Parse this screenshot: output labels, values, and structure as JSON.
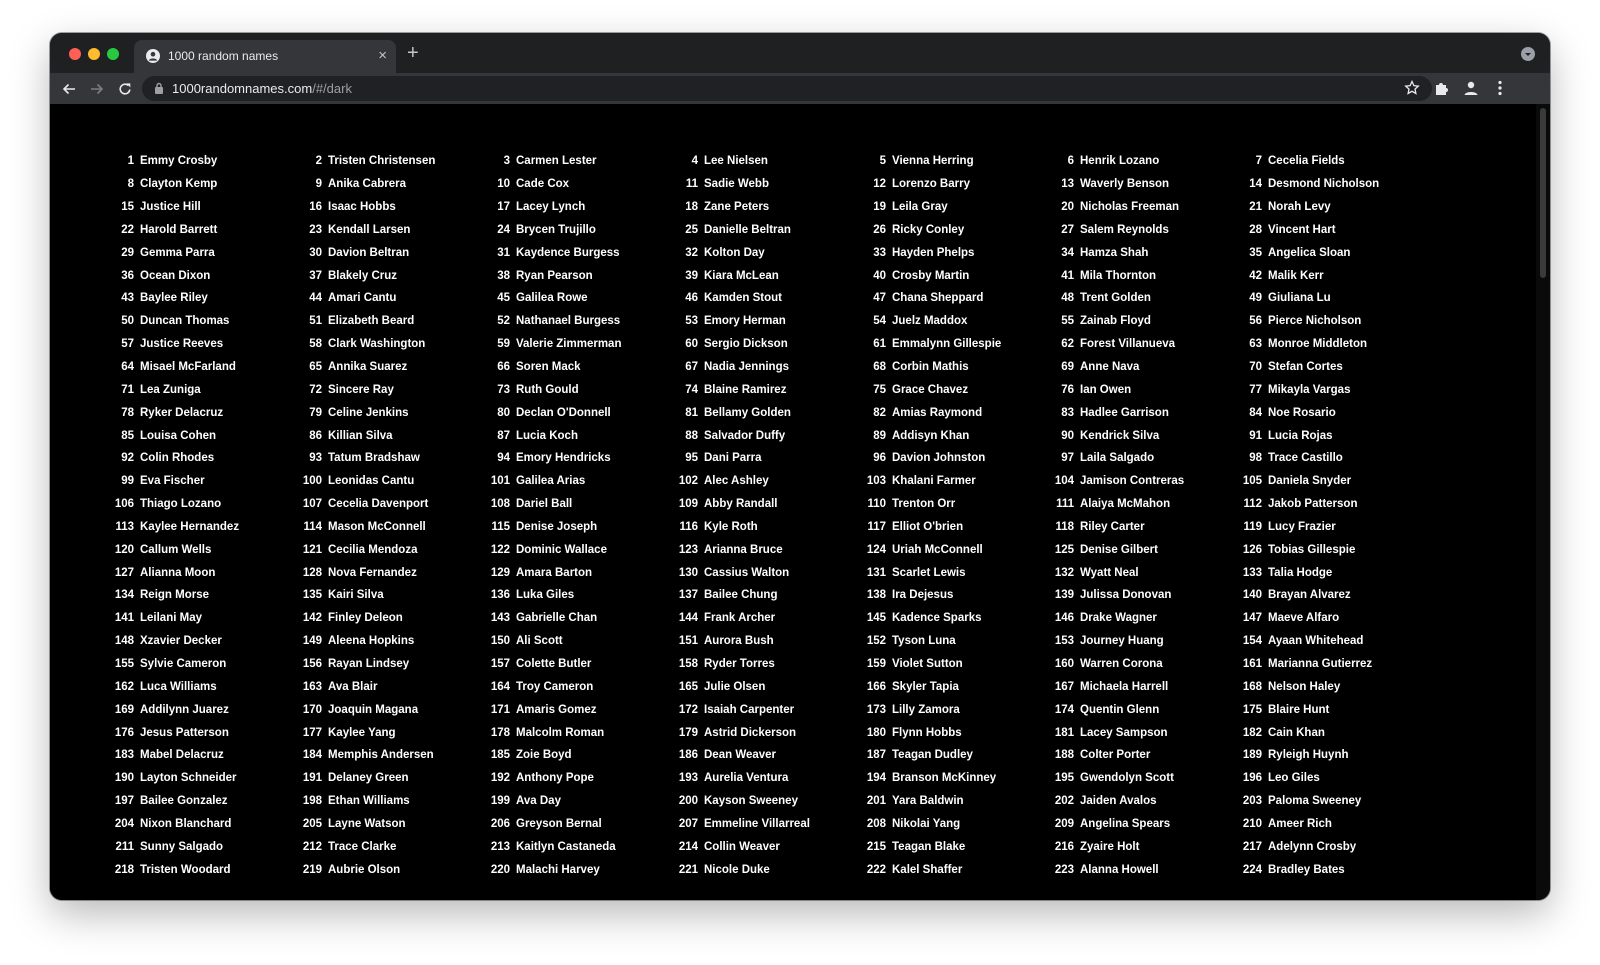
{
  "browser": {
    "tab_title": "1000 random names",
    "url_host": "1000randomnames.com",
    "url_path": "/#/dark",
    "tab_close_glyph": "×",
    "new_tab_glyph": "+"
  },
  "colors": {
    "page_background": "#000000",
    "text": "#ffffff",
    "tab_bar": "#1f2022",
    "toolbar": "#35363a"
  },
  "icons": [
    "back-icon",
    "forward-icon",
    "reload-icon",
    "lock-icon",
    "star-icon",
    "extensions-icon",
    "profile-icon",
    "menu-icon"
  ],
  "names": [
    "Emmy Crosby",
    "Tristen Christensen",
    "Carmen Lester",
    "Lee Nielsen",
    "Vienna Herring",
    "Henrik Lozano",
    "Cecelia Fields",
    "Clayton Kemp",
    "Anika Cabrera",
    "Cade Cox",
    "Sadie Webb",
    "Lorenzo Barry",
    "Waverly Benson",
    "Desmond Nicholson",
    "Justice Hill",
    "Isaac Hobbs",
    "Lacey Lynch",
    "Zane Peters",
    "Leila Gray",
    "Nicholas Freeman",
    "Norah Levy",
    "Harold Barrett",
    "Kendall Larsen",
    "Brycen Trujillo",
    "Danielle Beltran",
    "Ricky Conley",
    "Salem Reynolds",
    "Vincent Hart",
    "Gemma Parra",
    "Davion Beltran",
    "Kaydence Burgess",
    "Kolton Day",
    "Hayden Phelps",
    "Hamza Shah",
    "Angelica Sloan",
    "Ocean Dixon",
    "Blakely Cruz",
    "Ryan Pearson",
    "Kiara McLean",
    "Crosby Martin",
    "Mila Thornton",
    "Malik Kerr",
    "Baylee Riley",
    "Amari Cantu",
    "Galilea Rowe",
    "Kamden Stout",
    "Chana Sheppard",
    "Trent Golden",
    "Giuliana Lu",
    "Duncan Thomas",
    "Elizabeth Beard",
    "Nathanael Burgess",
    "Emory Herman",
    "Juelz Maddox",
    "Zainab Floyd",
    "Pierce Nicholson",
    "Justice Reeves",
    "Clark Washington",
    "Valerie Zimmerman",
    "Sergio Dickson",
    "Emmalynn Gillespie",
    "Forest Villanueva",
    "Monroe Middleton",
    "Misael McFarland",
    "Annika Suarez",
    "Soren Mack",
    "Nadia Jennings",
    "Corbin Mathis",
    "Anne Nava",
    "Stefan Cortes",
    "Lea Zuniga",
    "Sincere Ray",
    "Ruth Gould",
    "Blaine Ramirez",
    "Grace Chavez",
    "Ian Owen",
    "Mikayla Vargas",
    "Ryker Delacruz",
    "Celine Jenkins",
    "Declan O'Donnell",
    "Bellamy Golden",
    "Amias Raymond",
    "Hadlee Garrison",
    "Noe Rosario",
    "Louisa Cohen",
    "Killian Silva",
    "Lucia Koch",
    "Salvador Duffy",
    "Addisyn Khan",
    "Kendrick Silva",
    "Lucia Rojas",
    "Colin Rhodes",
    "Tatum Bradshaw",
    "Emory Hendricks",
    "Dani Parra",
    "Davion Johnston",
    "Laila Salgado",
    "Trace Castillo",
    "Eva Fischer",
    "Leonidas Cantu",
    "Galilea Arias",
    "Alec Ashley",
    "Khalani Farmer",
    "Jamison Contreras",
    "Daniela Snyder",
    "Thiago Lozano",
    "Cecelia Davenport",
    "Dariel Ball",
    "Abby Randall",
    "Trenton Orr",
    "Alaiya McMahon",
    "Jakob Patterson",
    "Kaylee Hernandez",
    "Mason McConnell",
    "Denise Joseph",
    "Kyle Roth",
    "Elliot O'brien",
    "Riley Carter",
    "Lucy Frazier",
    "Callum Wells",
    "Cecilia Mendoza",
    "Dominic Wallace",
    "Arianna Bruce",
    "Uriah McConnell",
    "Denise Gilbert",
    "Tobias Gillespie",
    "Alianna Moon",
    "Nova Fernandez",
    "Amara Barton",
    "Cassius Walton",
    "Scarlet Lewis",
    "Wyatt Neal",
    "Talia Hodge",
    "Reign Morse",
    "Kairi Silva",
    "Luka Giles",
    "Bailee Chung",
    "Ira Dejesus",
    "Julissa Donovan",
    "Brayan Alvarez",
    "Leilani May",
    "Finley Deleon",
    "Gabrielle Chan",
    "Frank Archer",
    "Kadence Sparks",
    "Drake Wagner",
    "Maeve Alfaro",
    "Xzavier Decker",
    "Aleena Hopkins",
    "Ali Scott",
    "Aurora Bush",
    "Tyson Luna",
    "Journey Huang",
    "Ayaan Whitehead",
    "Sylvie Cameron",
    "Rayan Lindsey",
    "Colette Butler",
    "Ryder Torres",
    "Violet Sutton",
    "Warren Corona",
    "Marianna Gutierrez",
    "Luca Williams",
    "Ava Blair",
    "Troy Cameron",
    "Julie Olsen",
    "Skyler Tapia",
    "Michaela Harrell",
    "Nelson Haley",
    "Addilynn Juarez",
    "Joaquin Magana",
    "Amaris Gomez",
    "Isaiah Carpenter",
    "Lilly Zamora",
    "Quentin Glenn",
    "Blaire Hunt",
    "Jesus Patterson",
    "Kaylee Yang",
    "Malcolm Roman",
    "Astrid Dickerson",
    "Flynn Hobbs",
    "Lacey Sampson",
    "Cain Khan",
    "Mabel Delacruz",
    "Memphis Andersen",
    "Zoie Boyd",
    "Dean Weaver",
    "Teagan Dudley",
    "Colter Porter",
    "Ryleigh Huynh",
    "Layton Schneider",
    "Delaney Green",
    "Anthony Pope",
    "Aurelia Ventura",
    "Branson McKinney",
    "Gwendolyn Scott",
    "Leo Giles",
    "Bailee Gonzalez",
    "Ethan Williams",
    "Ava Day",
    "Kayson Sweeney",
    "Yara Baldwin",
    "Jaiden Avalos",
    "Paloma Sweeney",
    "Nixon Blanchard",
    "Layne Watson",
    "Greyson Bernal",
    "Emmeline Villarreal",
    "Nikolai Yang",
    "Angelina Spears",
    "Ameer Rich",
    "Sunny Salgado",
    "Trace Clarke",
    "Kaitlyn Castaneda",
    "Collin Weaver",
    "Teagan Blake",
    "Zyaire Holt",
    "Adelynn Crosby",
    "Tristen Woodard",
    "Aubrie Olson",
    "Malachi Harvey",
    "Nicole Duke",
    "Kalel Shaffer",
    "Alanna Howell",
    "Bradley Bates"
  ]
}
